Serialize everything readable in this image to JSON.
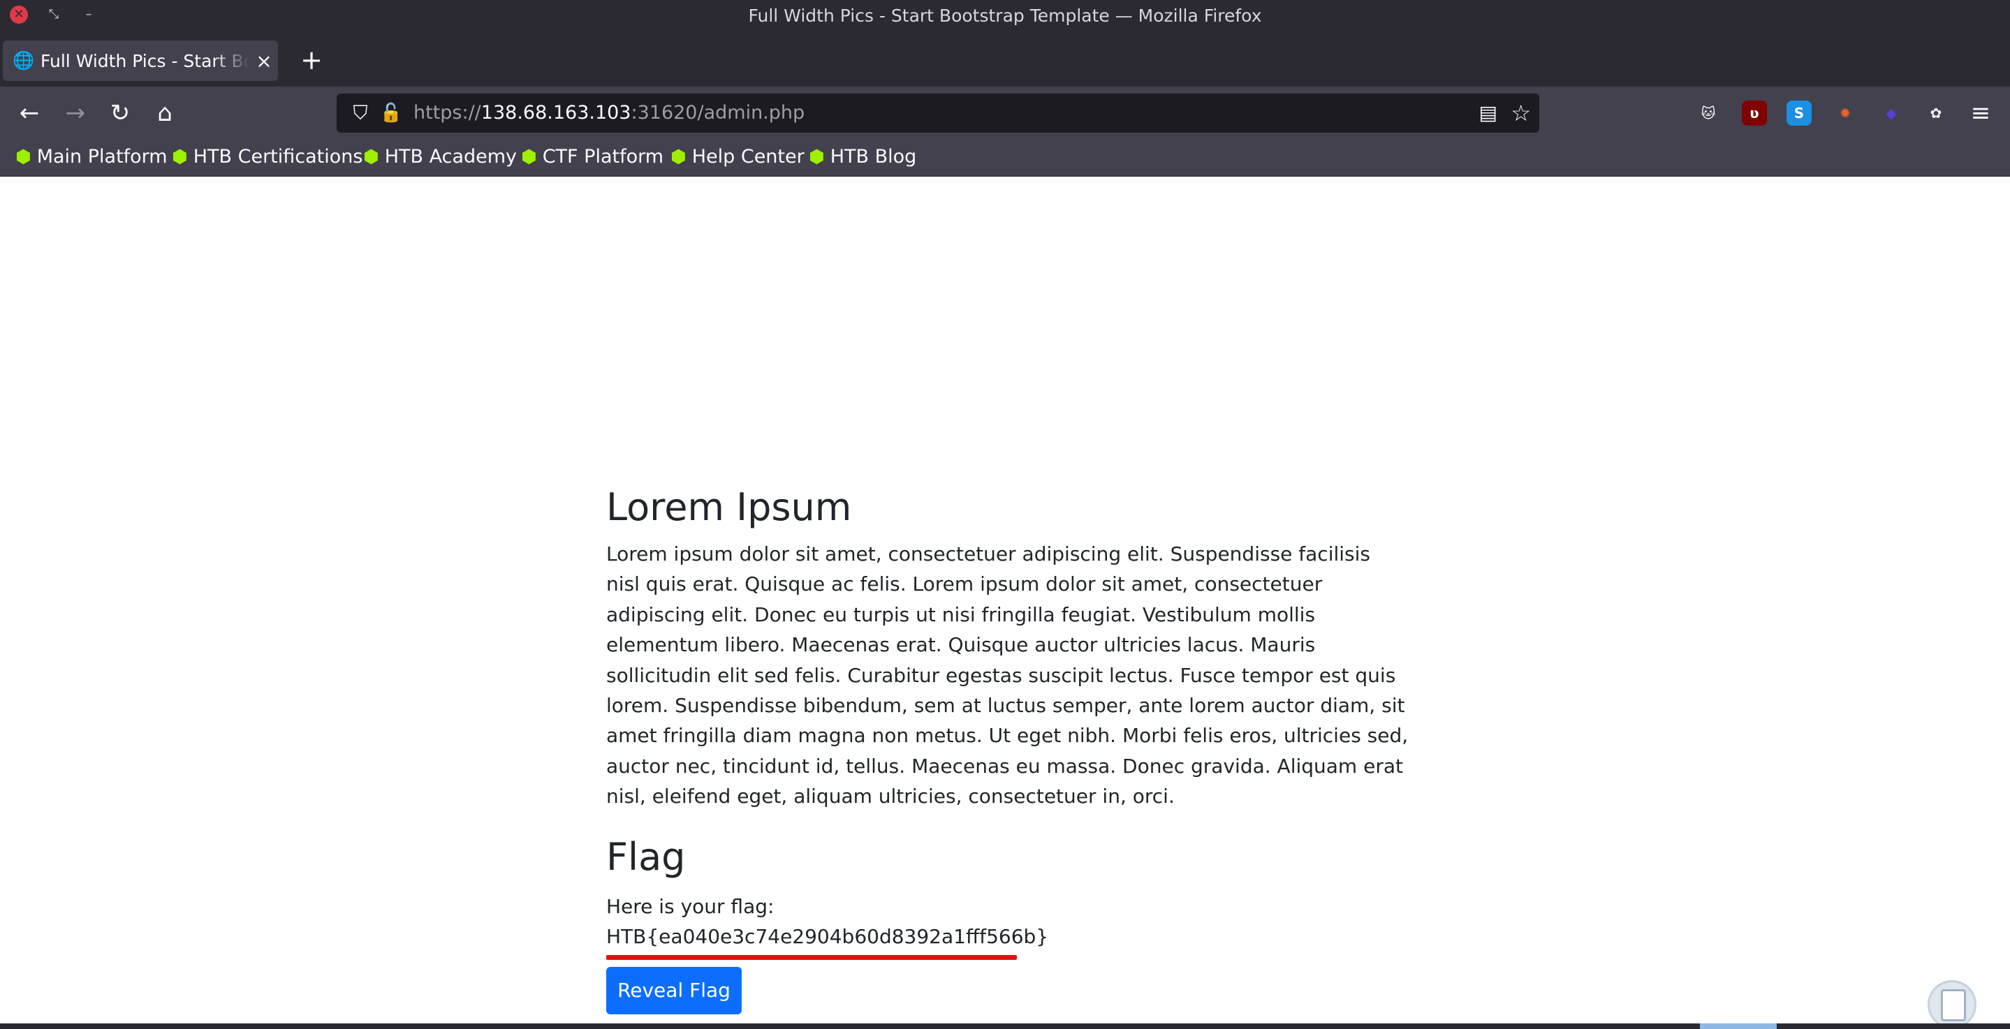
{
  "window": {
    "title": "Full Width Pics - Start Bootstrap Template — Mozilla Firefox",
    "close_glyph": "✕",
    "restore_glyph": "⤡",
    "minimize_glyph": "–"
  },
  "tabs": [
    {
      "label": "Full Width Pics - Start Bootstrap Template",
      "close_glyph": "×"
    }
  ],
  "new_tab_glyph": "+",
  "nav": {
    "back_glyph": "←",
    "forward_glyph": "→",
    "reload_glyph": "↻",
    "home_glyph": "⌂",
    "menu_glyph": "≡"
  },
  "url": {
    "scheme": "https://",
    "host": "138.68.163.103",
    "rest": ":31620/admin.php"
  },
  "extensions": [
    {
      "name": "ext-cat-icon",
      "glyph": "🐱",
      "color": "#42414d"
    },
    {
      "name": "ublock-origin-icon",
      "glyph": "ʋ",
      "color": "#800000"
    },
    {
      "name": "s-extension-icon",
      "glyph": "S",
      "color": "#1a8fe3"
    },
    {
      "name": "foxy-extension-icon",
      "glyph": "✹",
      "color": "#e8612c"
    },
    {
      "name": "purple-cube-extension-icon",
      "glyph": "◆",
      "color": "#5b3fd1"
    },
    {
      "name": "cookie-extension-icon",
      "glyph": "✿",
      "color": "#42414d"
    }
  ],
  "bookmarks": [
    "Main Platform",
    "HTB Certifications",
    "HTB Academy",
    "CTF Platform",
    "Help Center",
    "HTB Blog"
  ],
  "page": {
    "heading": "Lorem Ipsum",
    "paragraph": "Lorem ipsum dolor sit amet, consectetuer adipiscing elit. Suspendisse facilisis nisl quis erat. Quisque ac felis. Lorem ipsum dolor sit amet, consectetuer adipiscing elit. Donec eu turpis ut nisi fringilla feugiat. Vestibulum mollis elementum libero. Maecenas erat. Quisque auctor ultricies lacus. Mauris sollicitudin elit sed felis. Curabitur egestas suscipit lectus. Fusce tempor est quis lorem. Suspendisse bibendum, sem at luctus semper, ante lorem auctor diam, sit amet fringilla diam magna non metus. Ut eget nibh. Morbi felis eros, ultricies sed, auctor nec, tincidunt id, tellus. Maecenas eu massa. Donec gravida. Aliquam erat nisl, eleifend eget, aliquam ultricies, consectetuer in, orci.",
    "flag_heading": "Flag",
    "flag_label": "Here is your flag:",
    "flag_value": "HTB{ea040e3c74e2904b60d8392a1fff566b}",
    "reveal_button": "Reveal Flag"
  },
  "colors": {
    "chrome_dark": "#2b2a33",
    "chrome_toolbar": "#42414d",
    "bookmark_icon": "#9fef00",
    "button_primary": "#0d6efd",
    "annotation_underline": "#e01313"
  }
}
